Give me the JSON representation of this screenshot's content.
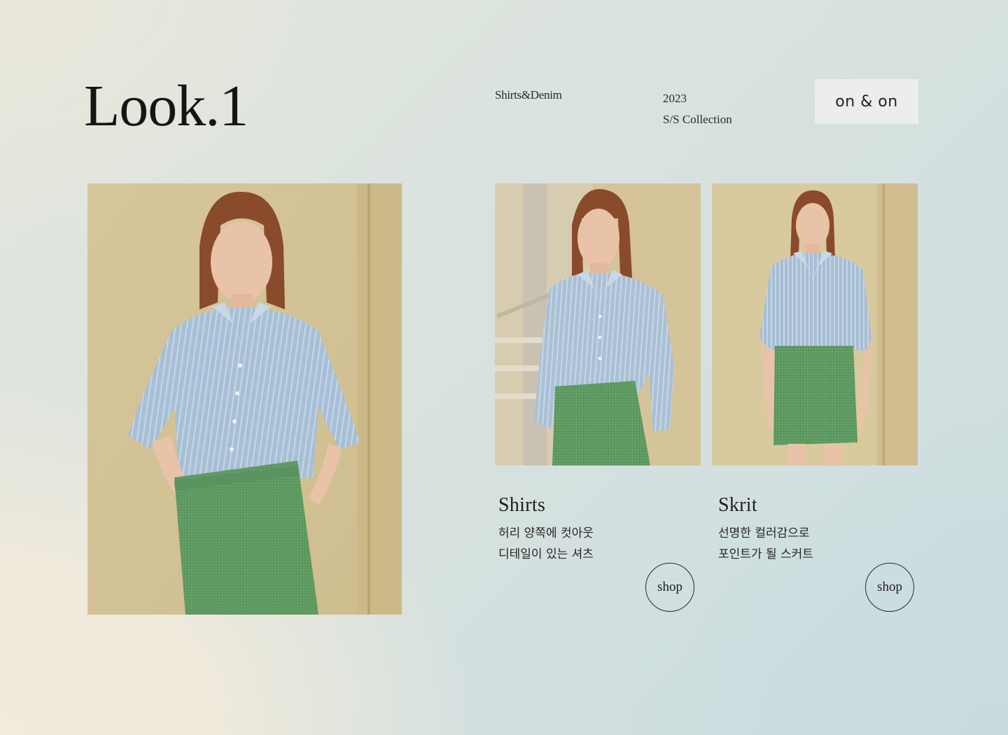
{
  "header": {
    "title": "Look.1",
    "category": "Shirts&Denim",
    "year": "2023",
    "collection": "S/S Collection",
    "brand": "on & on"
  },
  "products": [
    {
      "name": "Shirts",
      "desc_line1": "허리 양쪽에 컷아웃",
      "desc_line2": "디테일이 있는 셔츠",
      "shop_label": "shop"
    },
    {
      "name": "Skrit",
      "desc_line1": "선명한 컬러감으로",
      "desc_line2": "포인트가 될 스커트",
      "shop_label": "shop"
    }
  ],
  "colors": {
    "wall": "#d9c89a",
    "shirt": "#a9c0d6",
    "skirt": "#5f9a62",
    "hair": "#8a4a2c",
    "skin": "#e8c3a8",
    "brand_box": "#eceeec"
  }
}
